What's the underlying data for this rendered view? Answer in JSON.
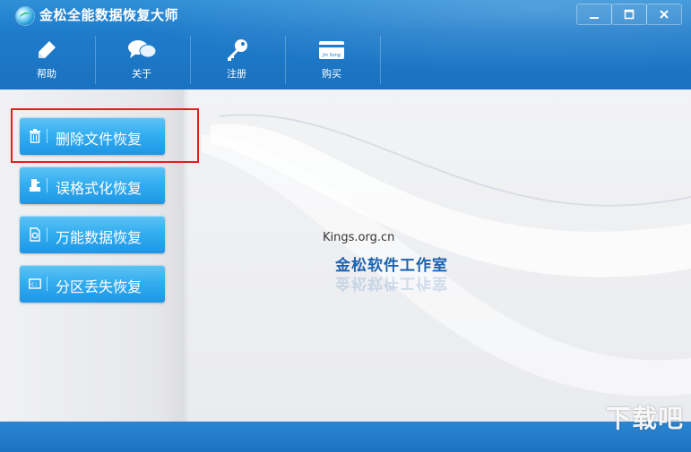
{
  "window": {
    "title": "金松全能数据恢复大师",
    "controls": {
      "minimize": "minimize",
      "maximize": "maximize",
      "close": "close"
    }
  },
  "toolbar": {
    "items": [
      {
        "label": "帮助",
        "icon": "pencil-icon"
      },
      {
        "label": "关于",
        "icon": "chat-bubble-icon"
      },
      {
        "label": "注册",
        "icon": "key-icon"
      },
      {
        "label": "购买",
        "icon": "card-icon",
        "icon_text": "Jin Song"
      }
    ]
  },
  "menu": {
    "items": [
      {
        "label": "删除文件恢复",
        "icon": "trash-icon"
      },
      {
        "label": "误格式化恢复",
        "icon": "format-icon"
      },
      {
        "label": "万能数据恢复",
        "icon": "disk-search-icon"
      },
      {
        "label": "分区丢失恢复",
        "icon": "partition-icon"
      }
    ],
    "highlighted_index": 0
  },
  "content": {
    "site": "Kings.org.cn",
    "studio": "金松软件工作室"
  },
  "watermark": "下载吧",
  "colors": {
    "accent": "#1f7ccb",
    "button": "#35aef0",
    "highlight": "#e02020",
    "studio": "#1c63b0"
  }
}
